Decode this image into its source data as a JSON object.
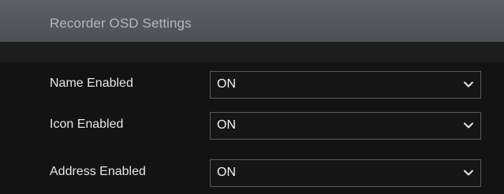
{
  "header": {
    "title": "Recorder OSD Settings"
  },
  "rows": [
    {
      "label": "Name Enabled",
      "value": "ON"
    },
    {
      "label": "Icon Enabled",
      "value": "ON"
    },
    {
      "label": "Address Enabled",
      "value": "ON"
    }
  ],
  "icons": {
    "dropdown": "chevron-down-icon"
  },
  "colors": {
    "header_bg": "#55595d",
    "panel_bg": "#131313",
    "label_text": "#e6e6e6",
    "select_border": "#5a5a5a"
  }
}
